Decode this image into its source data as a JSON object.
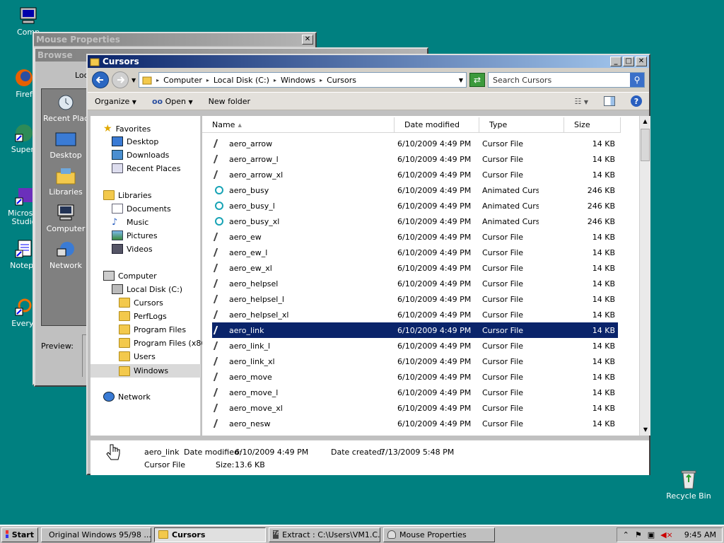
{
  "desktop": {
    "icons": [
      {
        "label": "Comp"
      },
      {
        "label": "Firef"
      },
      {
        "label": "Superr"
      },
      {
        "label": "Microsof Studio"
      },
      {
        "label": "Notepa"
      },
      {
        "label": "Everyt"
      },
      {
        "label": "Recycle Bin"
      }
    ]
  },
  "mouse_window": {
    "title": "Mouse Properties",
    "close": "✕"
  },
  "browse_window": {
    "title": "Browse",
    "look_label": "Loo",
    "preview_label": "Preview:",
    "places": [
      "Recent Plac",
      "Desktop",
      "Libraries",
      "Computer",
      "Network"
    ]
  },
  "explorer": {
    "title": "Cursors",
    "controls": {
      "minimize": "_",
      "maximize": "□",
      "close": "✕"
    },
    "address": {
      "crumbs": [
        "Computer",
        "Local Disk (C:)",
        "Windows",
        "Cursors"
      ]
    },
    "search_placeholder": "Search Cursors",
    "toolbar": {
      "organize": "Organize",
      "open": "Open",
      "new_folder": "New folder"
    },
    "nav": {
      "favorites": "Favorites",
      "desktop": "Desktop",
      "downloads": "Downloads",
      "recent": "Recent Places",
      "libraries": "Libraries",
      "documents": "Documents",
      "music": "Music",
      "pictures": "Pictures",
      "videos": "Videos",
      "computer": "Computer",
      "local_disk": "Local Disk (C:)",
      "folders": [
        "Cursors",
        "PerfLogs",
        "Program Files",
        "Program Files (x86)",
        "Users",
        "Windows"
      ],
      "network": "Network"
    },
    "columns": {
      "name": "Name",
      "date": "Date modified",
      "type": "Type",
      "size": "Size"
    },
    "files": [
      {
        "name": "aero_arrow",
        "date": "6/10/2009 4:49 PM",
        "type": "Cursor File",
        "size": "14 KB"
      },
      {
        "name": "aero_arrow_l",
        "date": "6/10/2009 4:49 PM",
        "type": "Cursor File",
        "size": "14 KB"
      },
      {
        "name": "aero_arrow_xl",
        "date": "6/10/2009 4:49 PM",
        "type": "Cursor File",
        "size": "14 KB"
      },
      {
        "name": "aero_busy",
        "date": "6/10/2009 4:49 PM",
        "type": "Animated Cursor",
        "size": "246 KB"
      },
      {
        "name": "aero_busy_l",
        "date": "6/10/2009 4:49 PM",
        "type": "Animated Cursor",
        "size": "246 KB"
      },
      {
        "name": "aero_busy_xl",
        "date": "6/10/2009 4:49 PM",
        "type": "Animated Cursor",
        "size": "246 KB"
      },
      {
        "name": "aero_ew",
        "date": "6/10/2009 4:49 PM",
        "type": "Cursor File",
        "size": "14 KB"
      },
      {
        "name": "aero_ew_l",
        "date": "6/10/2009 4:49 PM",
        "type": "Cursor File",
        "size": "14 KB"
      },
      {
        "name": "aero_ew_xl",
        "date": "6/10/2009 4:49 PM",
        "type": "Cursor File",
        "size": "14 KB"
      },
      {
        "name": "aero_helpsel",
        "date": "6/10/2009 4:49 PM",
        "type": "Cursor File",
        "size": "14 KB"
      },
      {
        "name": "aero_helpsel_l",
        "date": "6/10/2009 4:49 PM",
        "type": "Cursor File",
        "size": "14 KB"
      },
      {
        "name": "aero_helpsel_xl",
        "date": "6/10/2009 4:49 PM",
        "type": "Cursor File",
        "size": "14 KB"
      },
      {
        "name": "aero_link",
        "date": "6/10/2009 4:49 PM",
        "type": "Cursor File",
        "size": "14 KB"
      },
      {
        "name": "aero_link_l",
        "date": "6/10/2009 4:49 PM",
        "type": "Cursor File",
        "size": "14 KB"
      },
      {
        "name": "aero_link_xl",
        "date": "6/10/2009 4:49 PM",
        "type": "Cursor File",
        "size": "14 KB"
      },
      {
        "name": "aero_move",
        "date": "6/10/2009 4:49 PM",
        "type": "Cursor File",
        "size": "14 KB"
      },
      {
        "name": "aero_move_l",
        "date": "6/10/2009 4:49 PM",
        "type": "Cursor File",
        "size": "14 KB"
      },
      {
        "name": "aero_move_xl",
        "date": "6/10/2009 4:49 PM",
        "type": "Cursor File",
        "size": "14 KB"
      },
      {
        "name": "aero_nesw",
        "date": "6/10/2009 4:49 PM",
        "type": "Cursor File",
        "size": "14 KB"
      }
    ],
    "selected_index": 12,
    "details": {
      "name": "aero_link",
      "modified_label": "Date modified:",
      "modified": "6/10/2009 4:49 PM",
      "created_label": "Date created:",
      "created": "7/13/2009 5:48 PM",
      "type": "Cursor File",
      "size_label": "Size:",
      "size": "13.6 KB"
    }
  },
  "taskbar": {
    "start": "Start",
    "buttons": [
      "Original Windows 95/98 ...",
      "Cursors",
      "Extract : C:\\Users\\VM1.C...",
      "Mouse Properties"
    ],
    "clock": "9:45 AM"
  },
  "colors": {
    "desktop": "#008080",
    "title_active": "#0a246a",
    "selection": "#0a246a"
  }
}
